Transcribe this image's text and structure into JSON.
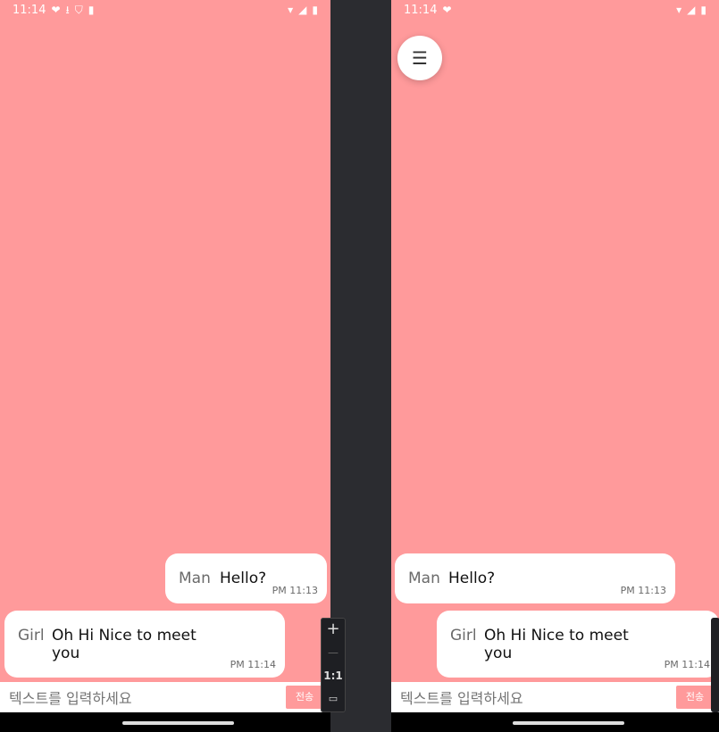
{
  "left": {
    "status": {
      "time": "11:14"
    },
    "messages": [
      {
        "sender": "Man",
        "text": "Hello?",
        "time": "PM 11:13"
      },
      {
        "sender": "Girl",
        "text": "Oh Hi Nice to meet you",
        "time": "PM 11:14"
      }
    ],
    "input": {
      "placeholder": "텍스트를 입력하세요",
      "send_label": "전송"
    }
  },
  "right": {
    "status": {
      "time": "11:14"
    },
    "messages": [
      {
        "sender": "Man",
        "text": "Hello?",
        "time": "PM 11:13"
      },
      {
        "sender": "Girl",
        "text": "Oh Hi Nice to meet you",
        "time": "PM 11:14"
      }
    ],
    "input": {
      "placeholder": "텍스트를 입력하세요",
      "send_label": "전송"
    }
  },
  "zoom_controls": {
    "plus": "+",
    "minus": "—",
    "ratio": "1:1"
  },
  "colors": {
    "background": "#ff9a9b",
    "bubble": "#ffffff",
    "send": "#ff9a9b"
  }
}
